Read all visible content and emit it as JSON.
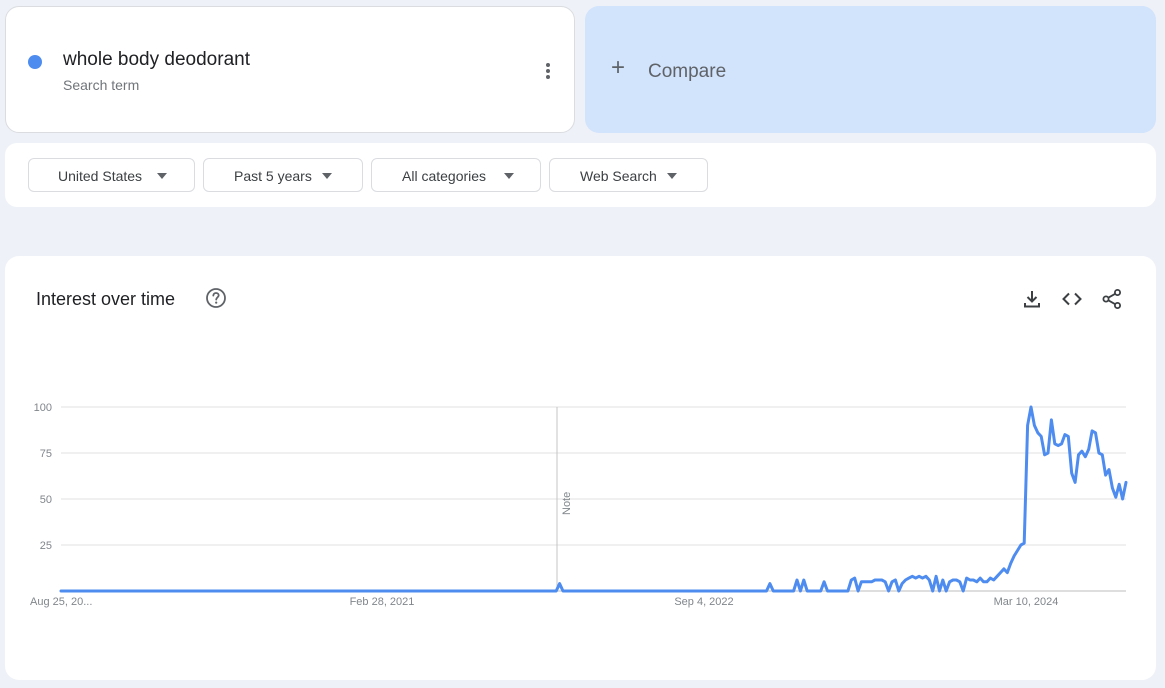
{
  "search_term": {
    "name": "whole body deodorant",
    "subtitle": "Search term",
    "color": "#4e8cf0"
  },
  "compare": {
    "plus": "+",
    "label": "Compare"
  },
  "filters": [
    {
      "label": "United States"
    },
    {
      "label": "Past 5 years"
    },
    {
      "label": "All categories"
    },
    {
      "label": "Web Search"
    }
  ],
  "panel": {
    "title": "Interest over time",
    "icons": [
      "help-icon",
      "download-icon",
      "embed-code-icon",
      "share-icon"
    ]
  },
  "chart_data": {
    "type": "line",
    "series": [
      {
        "color": "#4e8cf0",
        "values": [
          0,
          0,
          0,
          0,
          0,
          0,
          0,
          0,
          0,
          0,
          0,
          0,
          0,
          0,
          0,
          0,
          0,
          0,
          0,
          0,
          0,
          0,
          0,
          0,
          0,
          0,
          0,
          0,
          0,
          0,
          0,
          0,
          0,
          0,
          0,
          0,
          0,
          0,
          0,
          0,
          0,
          0,
          0,
          0,
          0,
          0,
          0,
          0,
          0,
          0,
          0,
          0,
          0,
          0,
          0,
          0,
          0,
          0,
          0,
          0,
          0,
          0,
          0,
          0,
          0,
          0,
          0,
          0,
          0,
          0,
          0,
          0,
          0,
          0,
          0,
          0,
          0,
          0,
          0,
          0,
          0,
          0,
          0,
          0,
          0,
          0,
          0,
          0,
          0,
          0,
          0,
          0,
          0,
          0,
          0,
          0,
          0,
          0,
          0,
          0,
          0,
          0,
          0,
          0,
          0,
          0,
          0,
          0,
          0,
          0,
          0,
          0,
          0,
          0,
          0,
          0,
          0,
          0,
          0,
          0,
          0,
          0,
          0,
          0,
          0,
          0,
          0,
          0,
          0,
          0,
          0,
          0,
          0,
          0,
          0,
          0,
          0,
          0,
          0,
          0,
          0,
          0,
          0,
          0,
          0,
          0,
          0,
          4,
          0,
          0,
          0,
          0,
          0,
          0,
          0,
          0,
          0,
          0,
          0,
          0,
          0,
          0,
          0,
          0,
          0,
          0,
          0,
          0,
          0,
          0,
          0,
          0,
          0,
          0,
          0,
          0,
          0,
          0,
          0,
          0,
          0,
          0,
          0,
          0,
          0,
          0,
          0,
          0,
          0,
          0,
          0,
          0,
          0,
          0,
          0,
          0,
          0,
          0,
          0,
          0,
          0,
          0,
          0,
          0,
          0,
          0,
          0,
          0,
          0,
          4,
          0,
          0,
          0,
          0,
          0,
          0,
          0,
          6,
          0,
          6,
          0,
          0,
          0,
          0,
          0,
          5,
          0,
          0,
          0,
          0,
          0,
          0,
          0,
          6,
          7,
          0,
          5,
          5,
          5,
          5,
          6,
          6,
          6,
          5,
          0,
          5,
          6,
          0,
          4,
          6,
          7,
          8,
          7,
          8,
          7,
          8,
          6,
          0,
          8,
          0,
          6,
          0,
          5,
          6,
          6,
          5,
          0,
          7,
          6,
          6,
          5,
          7,
          5,
          5,
          7,
          6,
          8,
          10,
          12,
          10,
          15,
          19,
          22,
          25,
          26,
          90,
          100,
          90,
          86,
          84,
          74,
          75,
          93,
          80,
          79,
          80,
          85,
          84,
          64,
          59,
          74,
          76,
          73,
          77,
          87,
          86,
          75,
          74,
          63,
          66,
          56,
          51,
          58,
          50,
          59
        ]
      }
    ],
    "x_labels": [
      "Aug 25, 20...",
      "Feb 28, 2021",
      "Sep 4, 2022",
      "Mar 10, 2024"
    ],
    "y_ticks": [
      100,
      75,
      50,
      25
    ],
    "ylim": [
      0,
      100
    ],
    "annotation": "Note",
    "grid": true
  }
}
